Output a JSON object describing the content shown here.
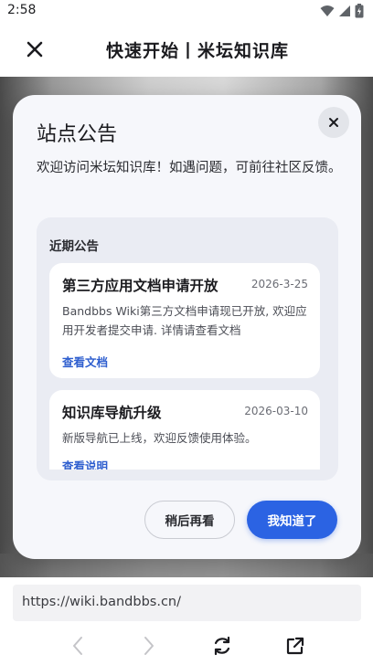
{
  "status_bar": {
    "time": "2:58"
  },
  "app_bar": {
    "title": "快速开始丨米坛知识库"
  },
  "dialog": {
    "title": "站点公告",
    "intro": "欢迎访问米坛知识库！如遇问题，可前往社区反馈。",
    "section_heading": "近期公告",
    "notices": [
      {
        "title": "第三方应用文档申请开放",
        "date": "2026-3-25",
        "body": "Bandbbs Wiki第三方文档申请现已开放, 欢迎应用开发者提交申请. 详情请查看文档",
        "link": "查看文档"
      },
      {
        "title": "知识库导航升级",
        "date": "2026-03-10",
        "body": "新版导航已上线，欢迎反馈使用体验。",
        "link": "查看说明"
      }
    ],
    "later_button": "稍后再看",
    "ok_button": "我知道了"
  },
  "url_bar": {
    "url": "https://wiki.bandbbs.cn/"
  },
  "colors": {
    "accent": "#2b63e3",
    "link": "#2f5fcf"
  }
}
